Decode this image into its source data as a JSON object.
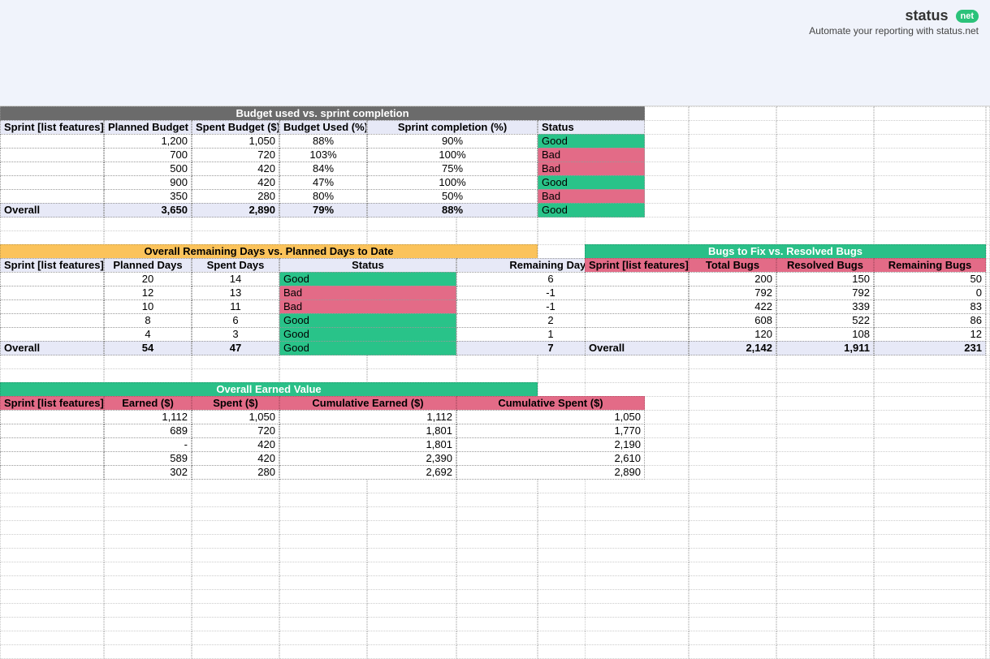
{
  "brand": {
    "name": "status",
    "pill": "net",
    "tagline": "Automate your reporting with status.net"
  },
  "labels": {
    "sprint_col": "Sprint [list features]",
    "overall": "Overall"
  },
  "budget": {
    "title": "Budget used vs. sprint completion",
    "headers": {
      "planned": "Planned Budget ($)",
      "spent": "Spent Budget ($)",
      "used_pct": "Budget Used (%)",
      "completion_pct": "Sprint completion (%)",
      "status": "Status"
    },
    "rows": [
      {
        "planned": "1,200",
        "spent": "1,050",
        "used_pct": "88%",
        "completion_pct": "90%",
        "status": "Good",
        "status_cls": "good"
      },
      {
        "planned": "700",
        "spent": "720",
        "used_pct": "103%",
        "completion_pct": "100%",
        "status": "Bad",
        "status_cls": "bad"
      },
      {
        "planned": "500",
        "spent": "420",
        "used_pct": "84%",
        "completion_pct": "75%",
        "status": "Bad",
        "status_cls": "bad"
      },
      {
        "planned": "900",
        "spent": "420",
        "used_pct": "47%",
        "completion_pct": "100%",
        "status": "Good",
        "status_cls": "good"
      },
      {
        "planned": "350",
        "spent": "280",
        "used_pct": "80%",
        "completion_pct": "50%",
        "status": "Bad",
        "status_cls": "bad"
      }
    ],
    "overall": {
      "planned": "3,650",
      "spent": "2,890",
      "used_pct": "79%",
      "completion_pct": "88%",
      "status": "Good",
      "status_cls": "good"
    }
  },
  "days": {
    "title": "Overall Remaining Days vs. Planned Days to Date",
    "headers": {
      "planned": "Planned Days",
      "spent": "Spent Days",
      "status": "Status",
      "remaining": "Remaining Days"
    },
    "rows": [
      {
        "planned": "20",
        "spent": "14",
        "status": "Good",
        "status_cls": "good",
        "remaining": "6"
      },
      {
        "planned": "12",
        "spent": "13",
        "status": "Bad",
        "status_cls": "bad",
        "remaining": "-1"
      },
      {
        "planned": "10",
        "spent": "11",
        "status": "Bad",
        "status_cls": "bad",
        "remaining": "-1"
      },
      {
        "planned": "8",
        "spent": "6",
        "status": "Good",
        "status_cls": "good",
        "remaining": "2"
      },
      {
        "planned": "4",
        "spent": "3",
        "status": "Good",
        "status_cls": "good",
        "remaining": "1"
      }
    ],
    "overall": {
      "planned": "54",
      "spent": "47",
      "status": "Good",
      "status_cls": "good",
      "remaining": "7"
    }
  },
  "bugs": {
    "title": "Bugs to Fix vs. Resolved Bugs",
    "headers": {
      "total": "Total Bugs",
      "resolved": "Resolved Bugs",
      "remaining": "Remaining Bugs"
    },
    "rows": [
      {
        "total": "200",
        "resolved": "150",
        "remaining": "50"
      },
      {
        "total": "792",
        "resolved": "792",
        "remaining": "0"
      },
      {
        "total": "422",
        "resolved": "339",
        "remaining": "83"
      },
      {
        "total": "608",
        "resolved": "522",
        "remaining": "86"
      },
      {
        "total": "120",
        "resolved": "108",
        "remaining": "12"
      }
    ],
    "overall": {
      "total": "2,142",
      "resolved": "1,911",
      "remaining": "231"
    }
  },
  "ev": {
    "title": "Overall Earned Value",
    "headers": {
      "earned": "Earned ($)",
      "spent": "Spent ($)",
      "cum_earned": "Cumulative Earned ($)",
      "cum_spent": "Cumulative Spent ($)"
    },
    "rows": [
      {
        "earned": "1,112",
        "spent": "1,050",
        "cum_earned": "1,112",
        "cum_spent": "1,050"
      },
      {
        "earned": "689",
        "spent": "720",
        "cum_earned": "1,801",
        "cum_spent": "1,770"
      },
      {
        "earned": "-",
        "spent": "420",
        "cum_earned": "1,801",
        "cum_spent": "2,190"
      },
      {
        "earned": "589",
        "spent": "420",
        "cum_earned": "2,390",
        "cum_spent": "2,610"
      },
      {
        "earned": "302",
        "spent": "280",
        "cum_earned": "2,692",
        "cum_spent": "2,890"
      }
    ]
  }
}
